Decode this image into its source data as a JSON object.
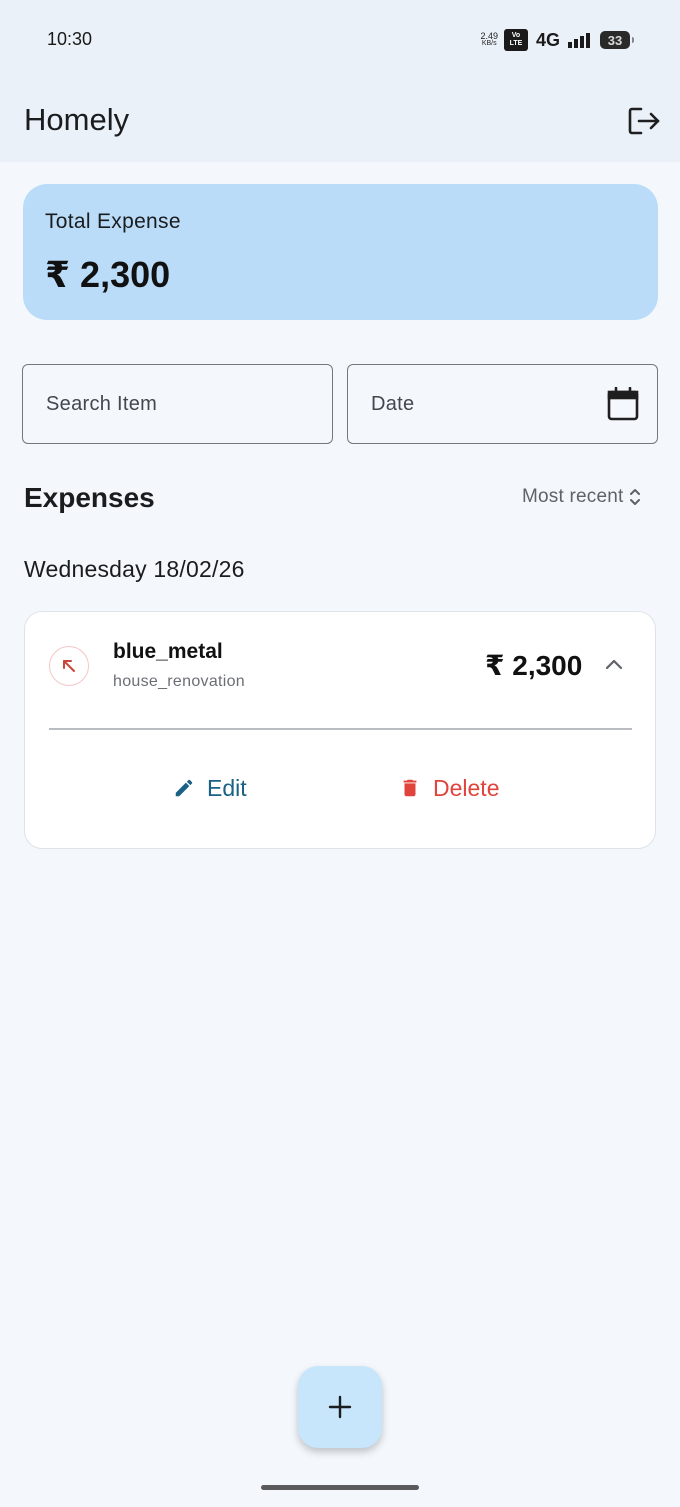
{
  "status_bar": {
    "time": "10:30",
    "net_speed_value": "2.49",
    "net_speed_unit": "KB/s",
    "volte_top": "Vo",
    "volte_bottom": "LTE",
    "network_type": "4G",
    "battery_level": "33"
  },
  "app_bar": {
    "title": "Homely",
    "logout_icon": "logout-icon"
  },
  "summary": {
    "label": "Total Expense",
    "amount": "₹ 2,300"
  },
  "filters": {
    "search_placeholder": "Search Item",
    "date_placeholder": "Date",
    "date_icon": "calendar-icon"
  },
  "expenses_section": {
    "title": "Expenses",
    "sort_label": "Most recent",
    "sort_icon": "unfold-icon"
  },
  "groups": [
    {
      "date": "Wednesday 18/02/26",
      "items": [
        {
          "name": "blue_metal",
          "category": "house_renovation",
          "amount": "₹ 2,300",
          "direction_icon": "arrow-outgoing-icon",
          "expanded": true,
          "edit_label": "Edit",
          "delete_label": "Delete"
        }
      ]
    }
  ],
  "colors": {
    "accent_card": "#badcf8",
    "edit": "#1a6186",
    "delete": "#e0443c",
    "fab": "#c7e5fb"
  },
  "fab": {
    "icon": "plus-icon"
  }
}
